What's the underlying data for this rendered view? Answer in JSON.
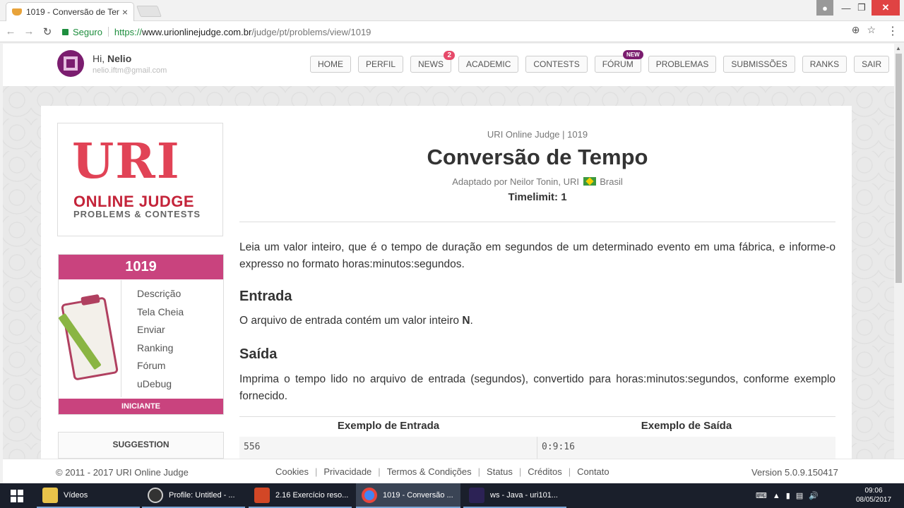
{
  "browser": {
    "tab_title": "1019 - Conversão de Ten",
    "secure_label": "Seguro",
    "url_scheme": "https://",
    "url_host": "www.urionlinejudge.com.br",
    "url_path": "/judge/pt/problems/view/1019"
  },
  "header": {
    "greeting_prefix": "Hi,",
    "user_name": "Nelio",
    "email": "nelio.iftm@gmail.com",
    "nav": [
      {
        "label": "HOME"
      },
      {
        "label": "PERFIL"
      },
      {
        "label": "NEWS",
        "badge": "2"
      },
      {
        "label": "ACADEMIC"
      },
      {
        "label": "CONTESTS"
      },
      {
        "label": "FÓRUM",
        "badge": "NEW"
      },
      {
        "label": "PROBLEMAS"
      },
      {
        "label": "SUBMISSÕES"
      },
      {
        "label": "RANKS"
      },
      {
        "label": "SAIR"
      }
    ]
  },
  "logo": {
    "uri": "URI",
    "online_judge": "ONLINE JUDGE",
    "tagline": "PROBLEMS & CONTESTS"
  },
  "problem_box": {
    "id": "1019",
    "menu": [
      "Descrição",
      "Tela Cheia",
      "Enviar",
      "Ranking",
      "Fórum",
      "uDebug"
    ],
    "level": "INICIANTE"
  },
  "suggestion": "SUGGESTION",
  "problem": {
    "crumb": "URI Online Judge | 1019",
    "title": "Conversão de Tempo",
    "author_prefix": "Adaptado por Neilor Tonin, URI",
    "country": "Brasil",
    "timelimit": "Timelimit: 1",
    "description": "Leia um valor inteiro, que é o tempo de duração em segundos de um determinado evento em uma fábrica, e informe-o expresso no formato horas:minutos:segundos.",
    "input_title": "Entrada",
    "input_text": "O arquivo de entrada contém um valor inteiro",
    "input_var": "N",
    "input_end": ".",
    "output_title": "Saída",
    "output_text": "Imprima o tempo lido no arquivo de entrada (segundos), convertido para horas:minutos:segundos, conforme exemplo fornecido.",
    "example_input_header": "Exemplo de Entrada",
    "example_output_header": "Exemplo de Saída",
    "example_input": "556",
    "example_output": "0:9:16"
  },
  "footer": {
    "copyright": "© 2011 - 2017 URI Online Judge",
    "links": [
      "Cookies",
      "Privacidade",
      "Termos & Condições",
      "Status",
      "Créditos",
      "Contato"
    ],
    "version": "Version 5.0.9.150417"
  },
  "taskbar": {
    "items": [
      {
        "label": "Vídeos",
        "color": "#e8c34a"
      },
      {
        "label": "Profile: Untitled - ...",
        "color": "#333333"
      },
      {
        "label": "2.16 Exercício reso...",
        "color": "#d24726"
      },
      {
        "label": "1019 - Conversão ...",
        "color": "#4285f4"
      },
      {
        "label": "ws - Java - uri101...",
        "color": "#2c2255"
      }
    ],
    "time": "09:06",
    "date": "08/05/2017"
  }
}
